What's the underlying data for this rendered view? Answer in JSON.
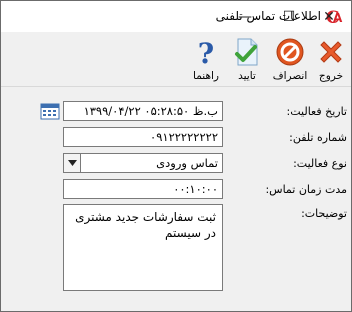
{
  "window": {
    "title": "اطلاعات تماس تلفنی",
    "minimize_glyph": "—",
    "maximize_glyph": "☐",
    "close_glyph": "✕"
  },
  "toolbar": {
    "exit_label": "خروج",
    "cancel_label": "انصراف",
    "confirm_label": "تایید",
    "help_label": "راهنما"
  },
  "form": {
    "activity_date": {
      "label": "تاریخ فعالیت:",
      "value": "۱۳۹۹/۰۴/۲۲ ۰۵:۲۸:۵۰ ب.ظ"
    },
    "phone_number": {
      "label": "شماره تلفن:",
      "value": "۰۹۱۲۲۲۲۲۲۲۲"
    },
    "activity_type": {
      "label": "نوع فعالیت:",
      "value": "تماس ورودی"
    },
    "call_duration": {
      "label": "مدت زمان تماس:",
      "value": "۰۰:۱۰:۰۰"
    },
    "description": {
      "label": "توضیحات:",
      "value": "ثبت سفارشات جدید مشتری در سیستم"
    }
  },
  "colors": {
    "exit_icon": "#e85a2c",
    "cancel_icon": "#e0551f",
    "confirm_check": "#3fa33a",
    "help_icon": "#2a5aa8",
    "logo": "#d8232a"
  }
}
